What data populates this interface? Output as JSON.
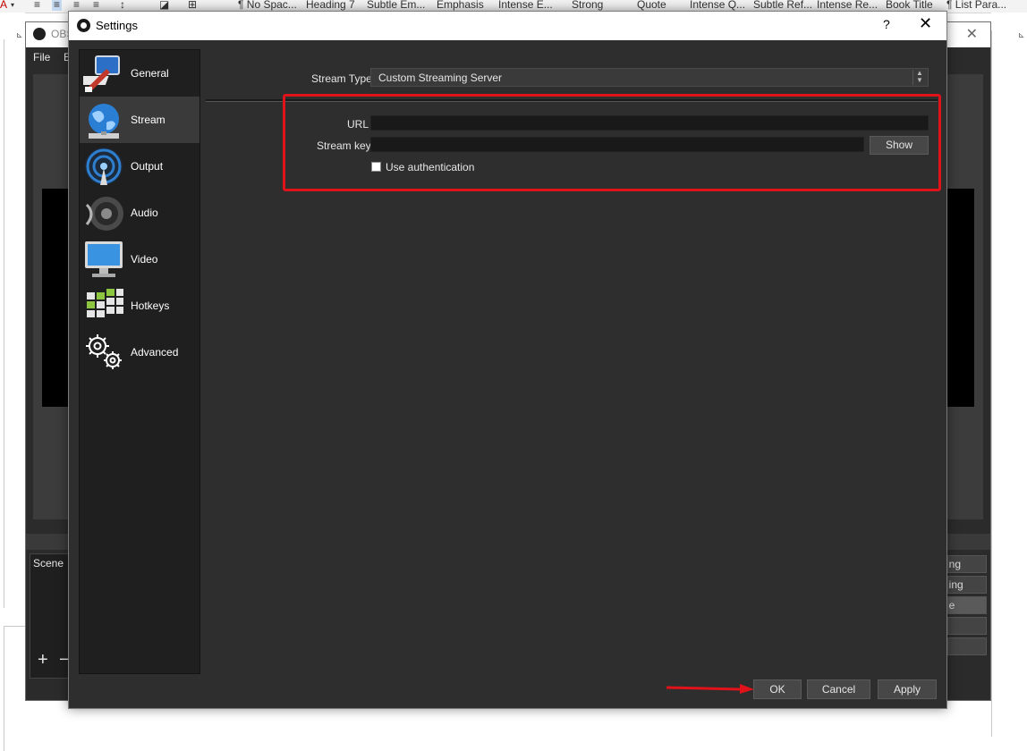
{
  "word": {
    "styles": [
      "¶ No Spac...",
      "Heading 7",
      "Subtle Em...",
      "Emphasis",
      "Intense E...",
      "Strong",
      "Quote",
      "Intense Q...",
      "Subtle Ref...",
      "Intense Re...",
      "Book Title",
      "¶ List Para..."
    ]
  },
  "obs": {
    "title": "OBS",
    "menu": [
      "File",
      "E"
    ],
    "scene_label": "Scene",
    "add_symbol": "+",
    "remove_symbol": "−",
    "controls_partial": [
      "ing",
      "ling",
      "le",
      "",
      ""
    ]
  },
  "settings": {
    "title": "Settings",
    "help": "?",
    "close": "✕",
    "nav": [
      {
        "label": "General",
        "icon": "general-icon"
      },
      {
        "label": "Stream",
        "icon": "stream-globe-icon"
      },
      {
        "label": "Output",
        "icon": "output-broadcast-icon"
      },
      {
        "label": "Audio",
        "icon": "speaker-icon"
      },
      {
        "label": "Video",
        "icon": "monitor-icon"
      },
      {
        "label": "Hotkeys",
        "icon": "keyboard-icon"
      },
      {
        "label": "Advanced",
        "icon": "gears-icon"
      }
    ],
    "selected_nav": "Stream",
    "stream_type_label": "Stream Type",
    "stream_type_value": "Custom Streaming Server",
    "url_label": "URL",
    "url_value": "",
    "stream_key_label": "Stream key",
    "stream_key_value": "",
    "show_label": "Show",
    "use_auth_label": "Use authentication",
    "use_auth_checked": false,
    "ok_label": "OK",
    "cancel_label": "Cancel",
    "apply_label": "Apply",
    "highlight_color": "#e0121a"
  }
}
